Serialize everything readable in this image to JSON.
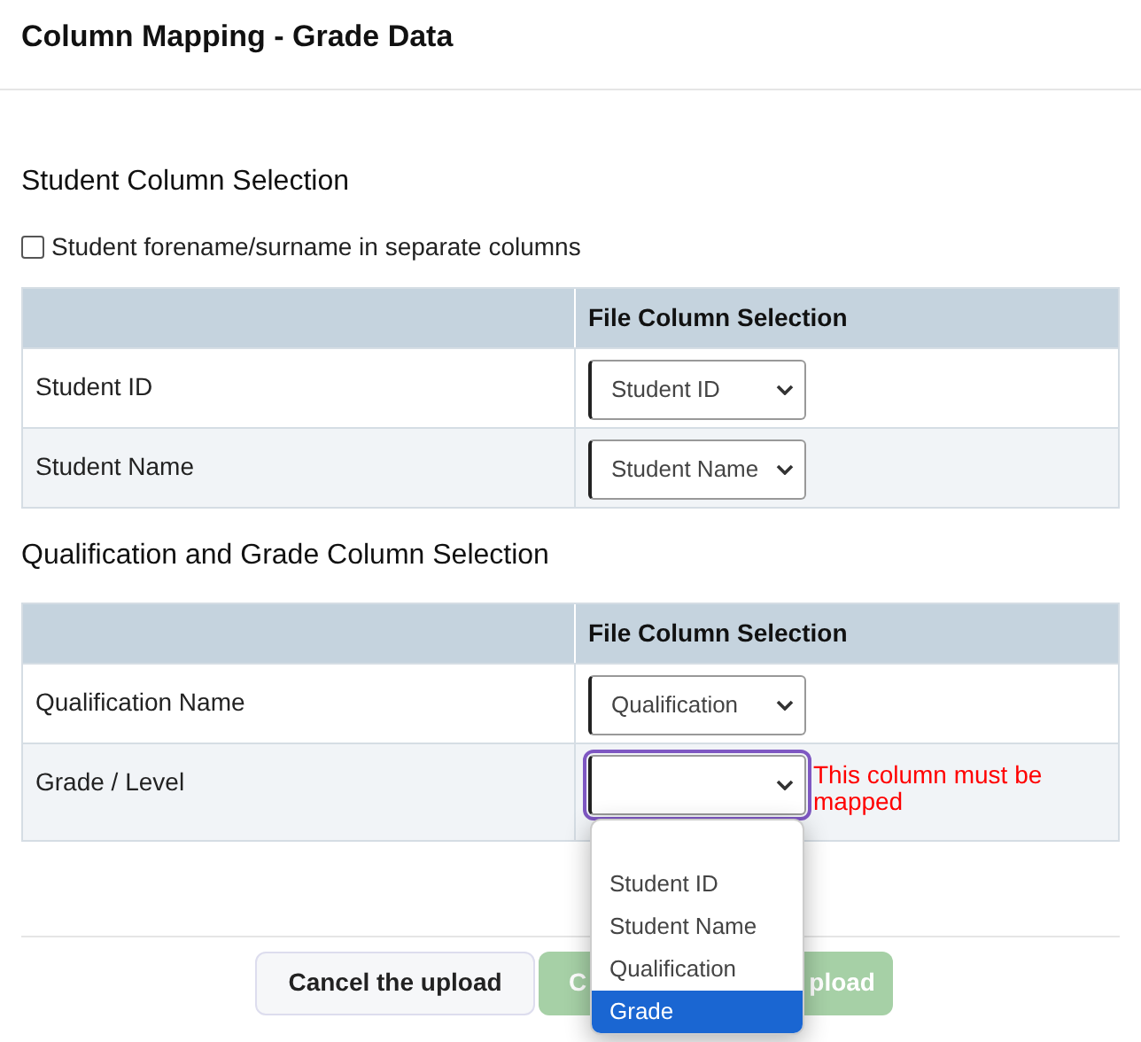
{
  "title": "Column Mapping - Grade Data",
  "sections": [
    {
      "heading": "Student Column Selection",
      "checkbox": {
        "label": "Student forename/surname in separate columns",
        "checked": false
      },
      "table": {
        "columns": [
          "File Column Selection"
        ],
        "rows": [
          {
            "label": "Student ID",
            "value": "Student ID",
            "focused": false
          },
          {
            "label": "Student Name",
            "value": "Student Name",
            "focused": false
          }
        ]
      }
    },
    {
      "heading": "Qualification and Grade Column Selection",
      "table": {
        "columns": [
          "File Column Selection"
        ],
        "rows": [
          {
            "label": "Qualification Name",
            "value": "Qualification",
            "focused": false
          },
          {
            "label": "Grade / Level",
            "focused": true,
            "error": "This column must be mapped",
            "dropdown": [
              {
                "label": "Student ID",
                "selected": false
              },
              {
                "label": "Student Name",
                "selected": false
              },
              {
                "label": "Qualification",
                "selected": false
              },
              {
                "label": "Grade",
                "selected": true
              }
            ]
          }
        ]
      }
    }
  ],
  "buttons": [
    {
      "kind": "secondary",
      "label": "Cancel the upload",
      "disabled": false
    },
    {
      "kind": "primary",
      "label_start": "C",
      "label_end": "pload",
      "disabled": true
    }
  ]
}
